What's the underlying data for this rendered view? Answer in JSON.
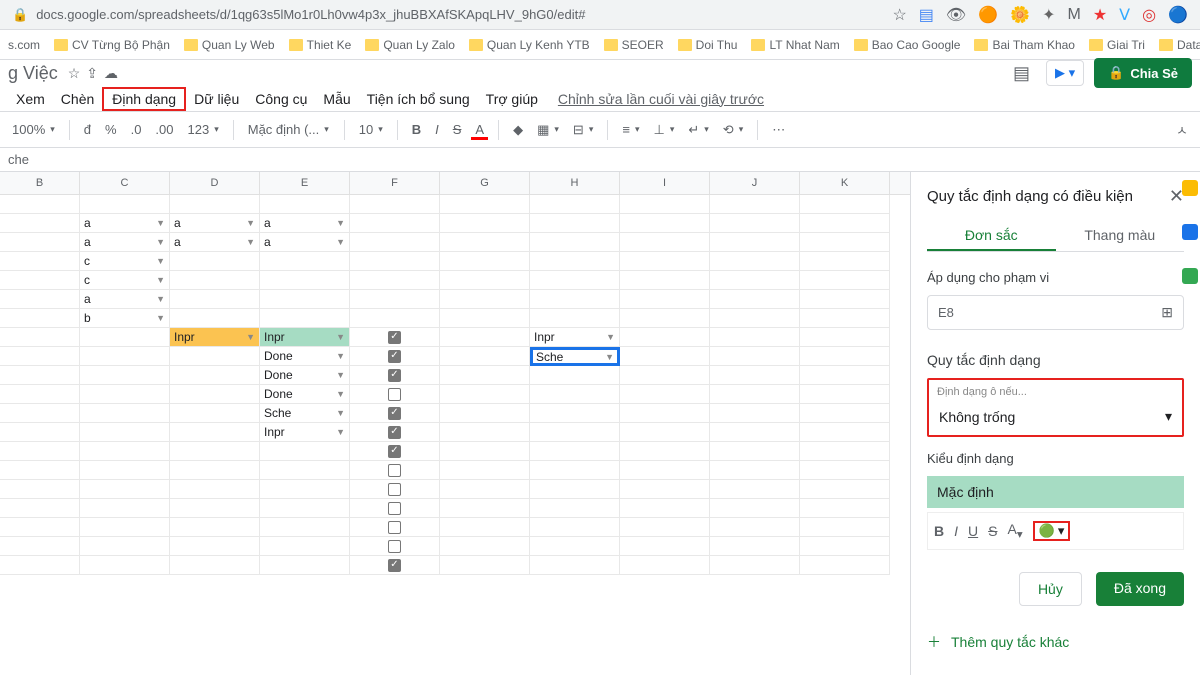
{
  "url": "docs.google.com/spreadsheets/d/1qg63s5lMo1r0Lh0vw4p3x_jhuBBXAfSKApqLHV_9hG0/edit#",
  "bookmarks": [
    {
      "label": "s.com"
    },
    {
      "label": "CV Từng Bộ Phận"
    },
    {
      "label": "Quan Ly Web"
    },
    {
      "label": "Thiet Ke"
    },
    {
      "label": "Quan Ly Zalo"
    },
    {
      "label": "Quan Ly Kenh YTB"
    },
    {
      "label": "SEOER"
    },
    {
      "label": "Doi Thu"
    },
    {
      "label": "LT Nhat Nam"
    },
    {
      "label": "Bao Cao Google"
    },
    {
      "label": "Bai Tham Khao"
    },
    {
      "label": "Giai Tri"
    },
    {
      "label": "Data Bao Cao"
    }
  ],
  "doc_title": "g Việc",
  "share_label": "Chia Sẻ",
  "menu": {
    "xem": "Xem",
    "chen": "Chèn",
    "dinhdang": "Định dạng",
    "dulieu": "Dữ liệu",
    "congcu": "Công cụ",
    "mau": "Mẫu",
    "tienich": "Tiện ích bổ sung",
    "trogiup": "Trợ giúp"
  },
  "lastedit": "Chỉnh sửa lần cuối vài giây trước",
  "toolbar": {
    "zoom": "100%",
    "currency": "đ",
    "pct": "%",
    "dec1": ".0",
    "dec2": ".00",
    "fmt": "123",
    "font": "Mặc định (...",
    "size": "10"
  },
  "fx": "che",
  "columns": [
    "B",
    "C",
    "D",
    "E",
    "F",
    "G",
    "H",
    "I",
    "J",
    "K"
  ],
  "rows": [
    {
      "c": "a",
      "d": "a",
      "e": "a"
    },
    {
      "c": "a",
      "d": "a",
      "e": "a"
    },
    {
      "c": "c"
    },
    {
      "c": "c"
    },
    {
      "c": "a"
    },
    {
      "c": "b"
    },
    {
      "d": "Inpr",
      "d_y": true,
      "e": "Inpr",
      "e_g": true,
      "f_chk": true,
      "h": "Inpr",
      "h_dd": true
    },
    {
      "e": "Done",
      "f_chk": true,
      "h": "Sche",
      "h_sel": true
    },
    {
      "e": "Done",
      "f_chk": true
    },
    {
      "e": "Done",
      "f_chk": false
    },
    {
      "e": "Sche",
      "f_chk": true
    },
    {
      "e": "Inpr",
      "f_chk": true
    },
    {
      "f_chk": true
    },
    {
      "f_chk": false
    },
    {
      "f_chk": false
    },
    {
      "f_chk": false
    },
    {
      "f_chk": false
    },
    {
      "f_chk": false
    },
    {
      "f_chk": true
    }
  ],
  "panel": {
    "title": "Quy tắc định dạng có điều kiện",
    "tab1": "Đơn sắc",
    "tab2": "Thang màu",
    "range_label": "Áp dụng cho phạm vi",
    "range": "E8",
    "rules_title": "Quy tắc định dạng",
    "if_label": "Định dạng ô nếu...",
    "if_value": "Không trống",
    "style_label": "Kiểu định dạng",
    "style_preview": "Mặc định",
    "cancel": "Hủy",
    "done": "Đã xong",
    "add": "Thêm quy tắc khác"
  }
}
